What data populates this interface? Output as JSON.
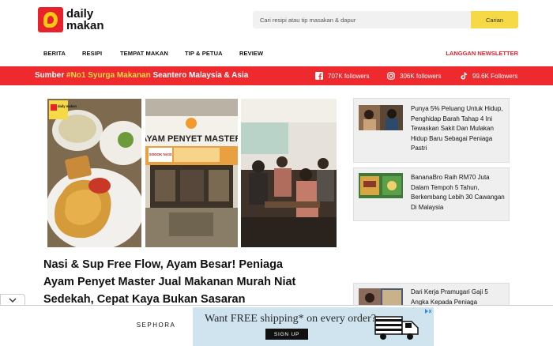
{
  "header": {
    "logo_text_line1": "daily",
    "logo_text_line2": "makan",
    "search_placeholder": "Cari resipi atau tip masakan & dapur",
    "search_button": "Carian"
  },
  "nav": {
    "items": [
      "BERITA",
      "RESIPI",
      "TEMPAT MAKAN",
      "TIP & PETUA",
      "REVIEW"
    ],
    "newsletter": "LANGGAN NEWSLETTER"
  },
  "banner": {
    "tagline_pre": "Sumber ",
    "tagline_highlight": "#No1 Syurga Makanan",
    "tagline_post": " Seantero Malaysia & Asia",
    "social": [
      {
        "icon": "facebook-icon",
        "label": "707K followers"
      },
      {
        "icon": "instagram-icon",
        "label": "306K followers"
      },
      {
        "icon": "tiktok-icon",
        "label": "99.6K Followers"
      }
    ]
  },
  "hero": {
    "sign_text": "AYAM PENYET MASTER",
    "badge_text": "daily makan",
    "sodok_text": "SODOK NASI"
  },
  "headline": "Nasi & Sup Free Flow, Ayam Besar! Peniaga Ayam Penyet Master Jual Makanan Murah Niat Sedekah, Cepat Kaya Bukan Sasaran",
  "sidebar": {
    "cards": [
      {
        "title": "Punya 5% Peluang Untuk Hidup, Penghidap Barah Tahap 4 Ini Tewaskan Sakit Dan Mulakan Hidup Baru Sebagai Peniaga Pastri"
      },
      {
        "title": "BananaBro Raih RM70 Juta Dalam Tempoh 5 Tahun, Berkembang Lebih 30 Cawangan Di Malaysia"
      },
      {
        "title": "Dari Kerja Pramugari Gaji 5 Angka Kepada Peniaga"
      }
    ]
  },
  "ad": {
    "brand": "SEPHORA",
    "message": "Want FREE shipping* on every order?",
    "button": "SIGN UP"
  },
  "colors": {
    "brand_red": "#ee2a2e",
    "brand_yellow": "#f6d947"
  }
}
